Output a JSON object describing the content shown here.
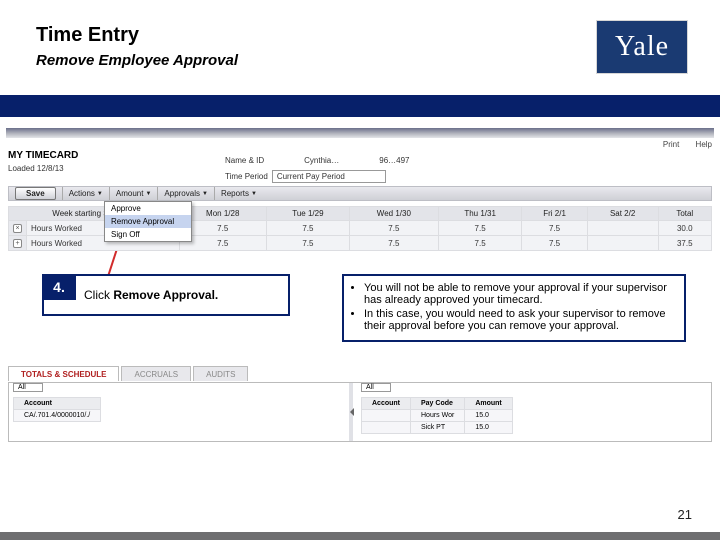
{
  "header": {
    "title": "Time Entry",
    "subtitle": "Remove Employee Approval",
    "logo_text": "Yale"
  },
  "screenshot": {
    "top_links": {
      "print": "Print",
      "help": "Help"
    },
    "section_title": "MY TIMECARD",
    "loaded": "Loaded 12/8/13",
    "name_label": "Name & ID",
    "name_value": "Cynthia…",
    "id_value": "96…497",
    "timeperiod_label": "Time Period",
    "timeperiod_value": "Current Pay Period",
    "toolbar": {
      "save": "Save",
      "actions": "Actions",
      "amount": "Amount",
      "approvals": "Approvals",
      "reports": "Reports"
    },
    "dropdown": {
      "approve": "Approve",
      "remove": "Remove Approval",
      "signoff": "Sign Off"
    },
    "grid": {
      "cols": [
        "Week starting Sun 1/27",
        "",
        "Mon 1/28",
        "Tue 1/29",
        "Wed 1/30",
        "Thu 1/31",
        "Fri 2/1",
        "Sat 2/2",
        "Total"
      ],
      "row1_label": "Hours Worked",
      "row2_label": "Hours Worked",
      "r1": [
        "",
        "7.5",
        "7.5",
        "7.5",
        "7.5",
        "7.5",
        "",
        "30.0"
      ],
      "r2": [
        "",
        "7.5",
        "7.5",
        "7.5",
        "7.5",
        "7.5",
        "",
        "37.5"
      ]
    },
    "tabs": {
      "totals": "TOTALS & SCHEDULE",
      "accruals": "ACCRUALS",
      "audits": "AUDITS"
    },
    "left_select": "All",
    "right_select": "All",
    "mg1_head": "Account",
    "mg1_row": "CA/.701.4/0000010/./",
    "mg2": {
      "h1": "Account",
      "h2": "Pay Code",
      "h3": "Amount",
      "r1c1": "",
      "r1c2": "Hours Wor",
      "r1c3": "15.0",
      "r2c1": "",
      "r2c2": "Sick PT",
      "r2c3": "15.0"
    }
  },
  "step": {
    "num": "4.",
    "text_before": "Click ",
    "text_bold": "Remove Approval.",
    "text_after": ""
  },
  "note": {
    "b1": "You will not be able to remove your approval if your supervisor has already approved your timecard.",
    "b2": "In this case, you would need to ask your supervisor to remove their approval before you can remove your approval."
  },
  "page_number": "21"
}
